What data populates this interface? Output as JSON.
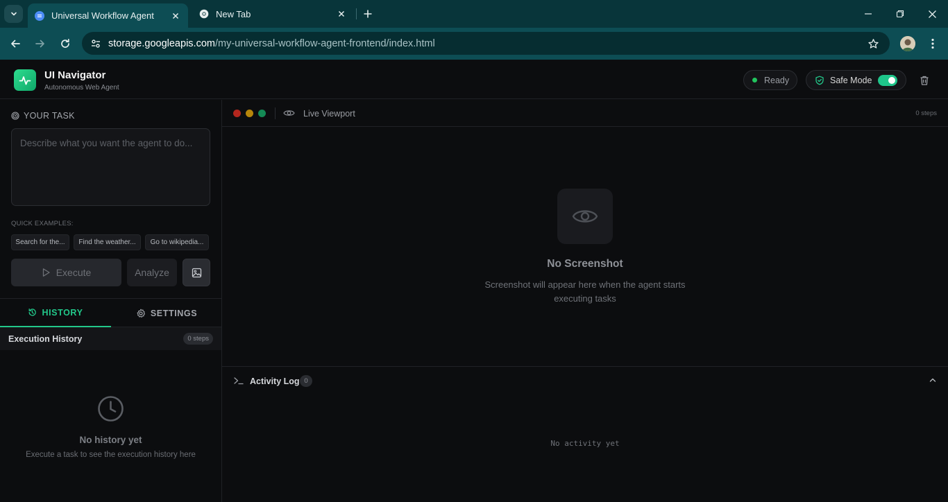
{
  "browser": {
    "tabs": [
      {
        "title": "Universal Workflow Agent",
        "active": true
      },
      {
        "title": "New Tab",
        "active": false
      }
    ],
    "url_host": "storage.googleapis.com",
    "url_path": "/my-universal-workflow-agent-frontend/index.html"
  },
  "header": {
    "app_title": "UI Navigator",
    "app_subtitle": "Autonomous Web Agent",
    "status": "Ready",
    "safe_mode_label": "Safe Mode",
    "safe_mode_on": true
  },
  "task": {
    "section_label": "YOUR TASK",
    "placeholder": "Describe what you want the agent to do...",
    "quick_examples_label": "QUICK EXAMPLES:",
    "quick_examples": [
      "Search for the...",
      "Find the weather...",
      "Go to wikipedia..."
    ],
    "execute_label": "Execute",
    "analyze_label": "Analyze"
  },
  "panel_tabs": {
    "history_label": "HISTORY",
    "settings_label": "SETTINGS"
  },
  "history": {
    "title": "Execution History",
    "count": "0 steps",
    "empty_title": "No history yet",
    "empty_subtitle": "Execute a task to see the execution history here"
  },
  "viewport": {
    "title": "Live Viewport",
    "steps": "0 steps",
    "empty_title": "No Screenshot",
    "empty_subtitle": "Screenshot will appear here when the agent starts executing tasks"
  },
  "activity": {
    "title": "Activity Log",
    "count": "0",
    "empty": "No activity yet"
  },
  "colors": {
    "accent": "#22c88a",
    "chrome_frame": "#08353a",
    "chrome_toolbar": "#0d4d54",
    "traffic_red": "#b3261e",
    "traffic_yellow": "#b7860b",
    "traffic_green": "#148a55"
  }
}
